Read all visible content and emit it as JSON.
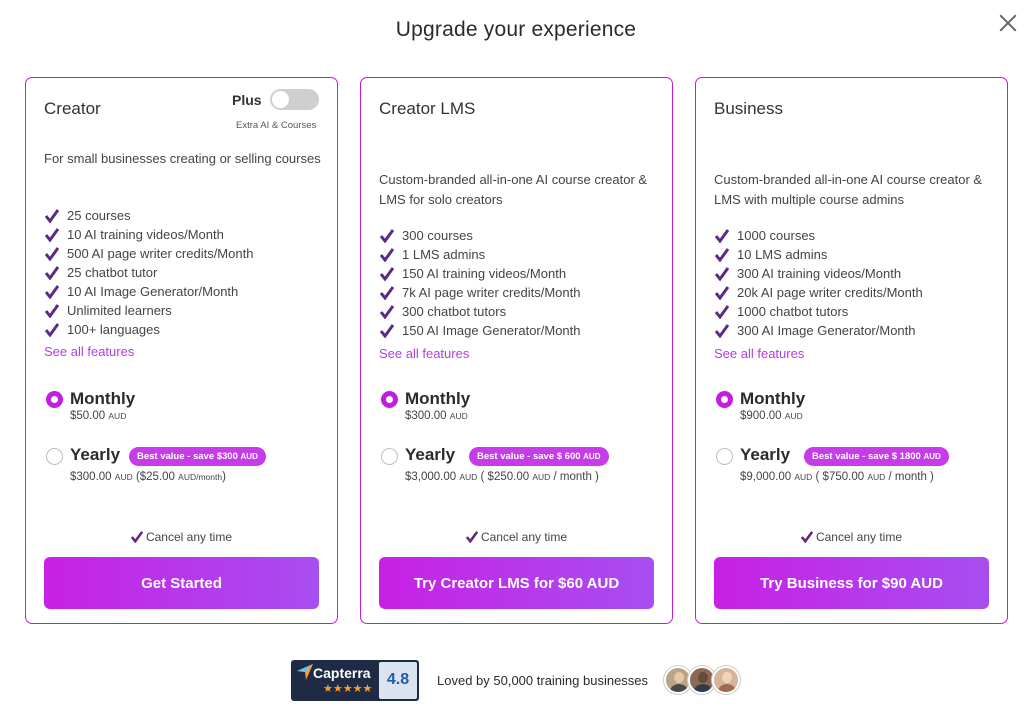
{
  "modal": {
    "title": "Upgrade your experience",
    "close_icon": "close-icon"
  },
  "colors": {
    "accent": "#c21cd9",
    "button_gradient_start": "#c820e6",
    "button_gradient_end": "#a74ef0",
    "check": "#5b2a86",
    "link": "#b43ee0",
    "badge": "#c53ce8"
  },
  "plans": [
    {
      "name": "Creator",
      "plus_label": "Plus",
      "plus_sub": "Extra AI & Courses",
      "plus_enabled": false,
      "description": "For small businesses creating or selling courses",
      "features": [
        "25  courses",
        "10  AI training videos/Month",
        "500  AI page writer credits/Month",
        "25  chatbot tutor",
        "10  AI Image Generator/Month",
        "Unlimited learners",
        "100+ languages"
      ],
      "see_all": "See all features",
      "monthly_label": "Monthly",
      "monthly_price": "$50.00",
      "monthly_currency": "AUD",
      "monthly_suffix": "",
      "yearly_label": "Yearly",
      "badge_text": "Best value - save $300",
      "badge_currency": "AUD",
      "yearly_price": "$300.00",
      "yearly_currency": "AUD",
      "yearly_extra": "($25.00",
      "yearly_extra_unit": "AUD/month",
      "yearly_extra_end": ")",
      "selected": "monthly",
      "cancel_text": "Cancel any time",
      "cta": "Get Started"
    },
    {
      "name": "Creator LMS",
      "description": "Custom-branded all-in-one AI course creator & LMS for solo creators",
      "features": [
        "300  courses",
        "1  LMS admins",
        "150  AI training videos/Month",
        "7k  AI page writer credits/Month",
        "300  chatbot tutors",
        "150  AI Image Generator/Month"
      ],
      "see_all": "See all features",
      "monthly_label": "Monthly",
      "monthly_price": "$300.00",
      "monthly_currency": "AUD",
      "yearly_label": "Yearly",
      "badge_text": "Best value - save $ 600",
      "badge_currency": "AUD",
      "yearly_price": "$3,000.00",
      "yearly_currency": "AUD",
      "yearly_extra": "( $250.00",
      "yearly_extra_unit": "AUD",
      "yearly_extra_end": "/ month )",
      "selected": "monthly",
      "cancel_text": "Cancel any time",
      "cta": "Try Creator LMS for $60 AUD"
    },
    {
      "name": "Business",
      "description": "Custom-branded all-in-one AI course creator & LMS with multiple course admins",
      "features": [
        "1000  courses",
        "10  LMS admins",
        "300  AI training videos/Month",
        "20k  AI page writer credits/Month",
        "1000  chatbot tutors",
        "300  AI Image Generator/Month"
      ],
      "see_all": "See all features",
      "monthly_label": "Monthly",
      "monthly_price": "$900.00",
      "monthly_currency": "AUD",
      "yearly_label": "Yearly",
      "badge_text": "Best value - save $ 1800",
      "badge_currency": "AUD",
      "yearly_price": "$9,000.00",
      "yearly_currency": "AUD",
      "yearly_extra": "( $750.00",
      "yearly_extra_unit": "AUD",
      "yearly_extra_end": "/ month )",
      "selected": "monthly",
      "cancel_text": "Cancel any time",
      "cta": "Try Business for $90 AUD"
    }
  ],
  "footer": {
    "capterra_name": "Capterra",
    "capterra_rating": "4.8",
    "capterra_stars": 5,
    "loved_text": "Loved by 50,000 training businesses",
    "avatars": [
      "avatar-user-1",
      "avatar-user-2",
      "avatar-user-3"
    ]
  }
}
